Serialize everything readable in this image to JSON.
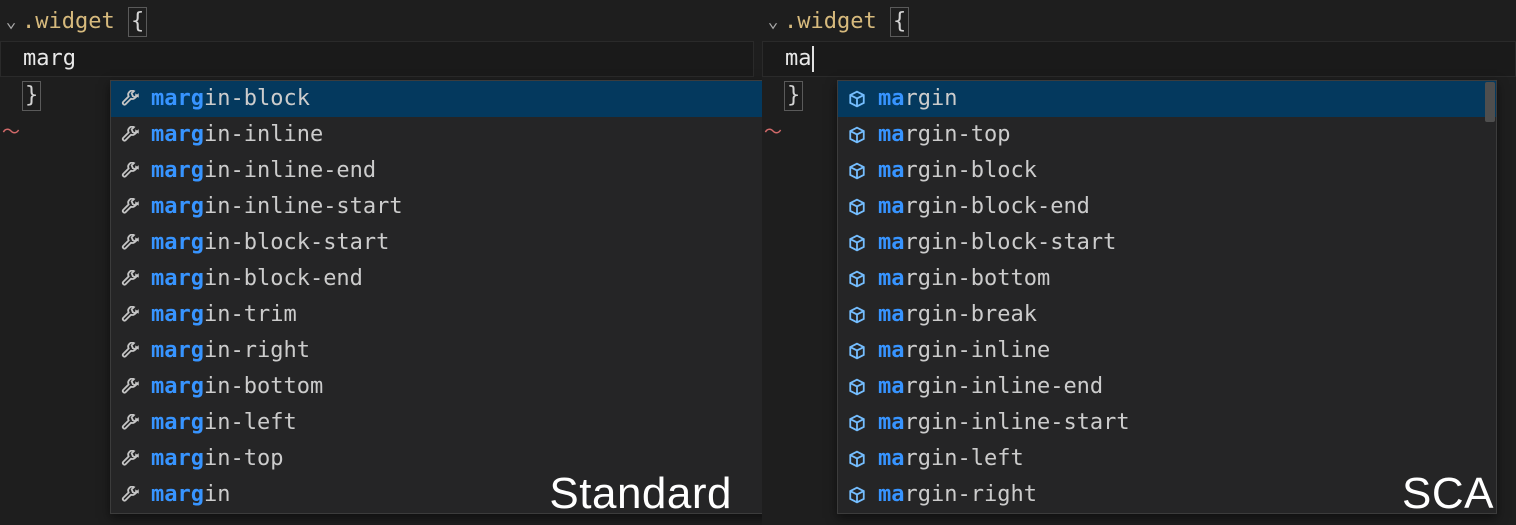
{
  "left": {
    "selector": ".widget",
    "typed": "marg",
    "match_len": 4,
    "label": "Standard",
    "suggestions": [
      "margin-block",
      "margin-inline",
      "margin-inline-end",
      "margin-inline-start",
      "margin-block-start",
      "margin-block-end",
      "margin-trim",
      "margin-right",
      "margin-bottom",
      "margin-left",
      "margin-top",
      "margin"
    ],
    "selected_index": 0,
    "icon": "wrench"
  },
  "right": {
    "selector": ".widget",
    "typed": "ma",
    "match_len": 2,
    "label": "SCA",
    "suggestions": [
      "margin",
      "margin-top",
      "margin-block",
      "margin-block-end",
      "margin-block-start",
      "margin-bottom",
      "margin-break",
      "margin-inline",
      "margin-inline-end",
      "margin-inline-start",
      "margin-left",
      "margin-right"
    ],
    "selected_index": 0,
    "icon": "cube"
  }
}
